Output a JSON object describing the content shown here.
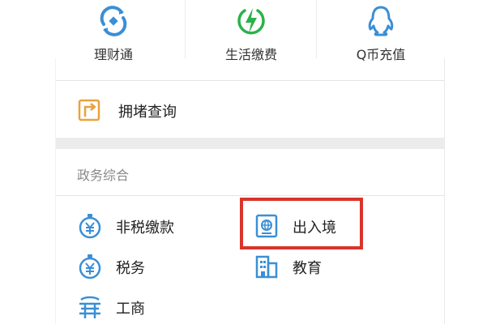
{
  "top_services": [
    {
      "label": "理财通",
      "icon": "licaitong-icon"
    },
    {
      "label": "生活缴费",
      "icon": "lightning-icon"
    },
    {
      "label": "Q币充值",
      "icon": "qq-penguin-icon"
    }
  ],
  "jam_query": {
    "label": "拥堵查询",
    "icon": "route-sign-icon"
  },
  "section": {
    "title": "政务综合",
    "items": [
      {
        "label": "非税缴款",
        "icon": "yuan-stopwatch-icon"
      },
      {
        "label": "出入境",
        "icon": "passport-icon"
      },
      {
        "label": "税务",
        "icon": "yuan-stopwatch-icon"
      },
      {
        "label": "教育",
        "icon": "school-building-icon"
      },
      {
        "label": "工商",
        "icon": "business-icon"
      }
    ]
  },
  "colors": {
    "icon_blue": "#3a8fd6",
    "icon_green": "#2ab24a",
    "icon_orange": "#e8a23d",
    "highlight_red": "#d9342b"
  }
}
